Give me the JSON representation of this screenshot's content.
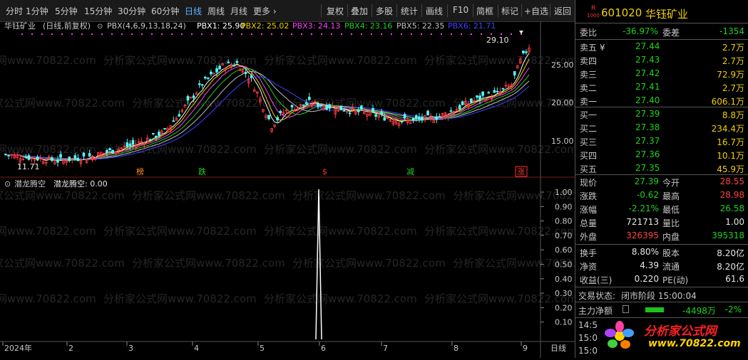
{
  "toolbar": {
    "periods": [
      "分时",
      "1分钟",
      "5分钟",
      "15分钟",
      "30分钟",
      "60分钟",
      "日线",
      "周线",
      "月线",
      "更多 ›"
    ],
    "active_period": "日线",
    "tools": [
      "复权",
      "叠加",
      "多股",
      "统计",
      "画线",
      "F10",
      "简框",
      "标记",
      "+自选",
      "返回"
    ]
  },
  "chart": {
    "stock_name": "华钰矿业",
    "mode": "(日线,前复权)",
    "indicator": "PBX(4,6,9,13,18,24)",
    "pbx": [
      {
        "label": "PBX1: 25.90",
        "color": "#ffffff"
      },
      {
        "label": "PBX2: 25.02",
        "color": "#f0d000"
      },
      {
        "label": "PBX3: 24.13",
        "color": "#ff40ff"
      },
      {
        "label": "PBX4: 23.16",
        "color": "#20d020"
      },
      {
        "label": "PBX5: 22.35",
        "color": "#c0c0c0"
      },
      {
        "label": "PBX6: 21.71",
        "color": "#4040ff"
      }
    ],
    "high_label": "29.10",
    "low_label": "11.71",
    "price_ticks": [
      "25.00",
      "20.00",
      "15.00"
    ],
    "markers": [
      {
        "text": "榜",
        "color": "#ff8c20"
      },
      {
        "text": "跌",
        "color": "#20d020"
      },
      {
        "text": "$",
        "color": "#ff3030"
      },
      {
        "text": "减",
        "color": "#20d020"
      },
      {
        "text": "涨",
        "color": "#ff3030"
      }
    ],
    "sub_title": "潜龙腾空",
    "sub_value": "潜龙腾空: 0.00",
    "sub_ticks": [
      "1.00",
      "0.90",
      "0.80",
      "0.70",
      "0.60",
      "0.50",
      "0.40",
      "0.30",
      "0.20",
      "0.10"
    ],
    "date_labels": [
      "2024年",
      "2",
      "3",
      "4",
      "5",
      "6",
      "7",
      "8",
      "9"
    ],
    "period_label": "日线",
    "watermark": "分析家公式网www.70822.com"
  },
  "panel": {
    "code": "601020",
    "name": "华钰矿业",
    "badge_top": "R",
    "badge_bottom": "1000",
    "weibi_label": "委比",
    "weibi": "-36.97%",
    "weicha_label": "委差",
    "weicha": "-1354",
    "asks": [
      {
        "label": "卖五 ¥",
        "price": "27.44",
        "vol": "2.7万"
      },
      {
        "label": "卖四",
        "price": "27.43",
        "vol": "2.7万"
      },
      {
        "label": "卖三",
        "price": "27.42",
        "vol": "72.9万"
      },
      {
        "label": "卖二",
        "price": "27.41",
        "vol": "2.7万"
      },
      {
        "label": "卖一",
        "price": "27.40",
        "vol": "606.1万"
      }
    ],
    "bids": [
      {
        "label": "买一",
        "price": "27.39",
        "vol": "8.8万"
      },
      {
        "label": "买二",
        "price": "27.38",
        "vol": "234.4万"
      },
      {
        "label": "买三",
        "price": "27.37",
        "vol": "16.7万"
      },
      {
        "label": "买四",
        "price": "27.36",
        "vol": "10.1万"
      },
      {
        "label": "买五",
        "price": "27.35",
        "vol": "45.9万"
      }
    ],
    "stats": [
      {
        "l1": "现价",
        "v1": "27.39",
        "c1": "green",
        "l2": "今开",
        "v2": "28.55",
        "c2": "red"
      },
      {
        "l1": "涨跌",
        "v1": "-0.62",
        "c1": "green",
        "l2": "最高",
        "v2": "28.98",
        "c2": "red"
      },
      {
        "l1": "涨幅",
        "v1": "-2.21%",
        "c1": "green",
        "l2": "最低",
        "v2": "26.58",
        "c2": "green"
      },
      {
        "l1": "总量",
        "v1": "721713",
        "c1": "white",
        "l2": "量比",
        "v2": "1.00",
        "c2": "white"
      },
      {
        "l1": "外盘",
        "v1": "326395",
        "c1": "red",
        "l2": "内盘",
        "v2": "395318",
        "c2": "green"
      }
    ],
    "stats2": [
      {
        "l1": "换手",
        "v1": "8.80%",
        "l2": "股本",
        "v2": "8.20亿"
      },
      {
        "l1": "净资",
        "v1": "4.39",
        "l2": "流通",
        "v2": "8.20亿"
      },
      {
        "l1": "收益(三)",
        "v1": "0.220",
        "l2": "PE(动)",
        "v2": "61.6"
      }
    ],
    "status_label": "交易状态:",
    "status_value": "闭市阶段 15:00:04",
    "netflow_label": "主力净额",
    "netflow_value": "-4498万",
    "netflow_pct": "-2%",
    "times": [
      "14:5",
      "15:0",
      "15:0"
    ],
    "logo_text": "分析家公式网",
    "logo_url": "www.70822.com"
  }
}
